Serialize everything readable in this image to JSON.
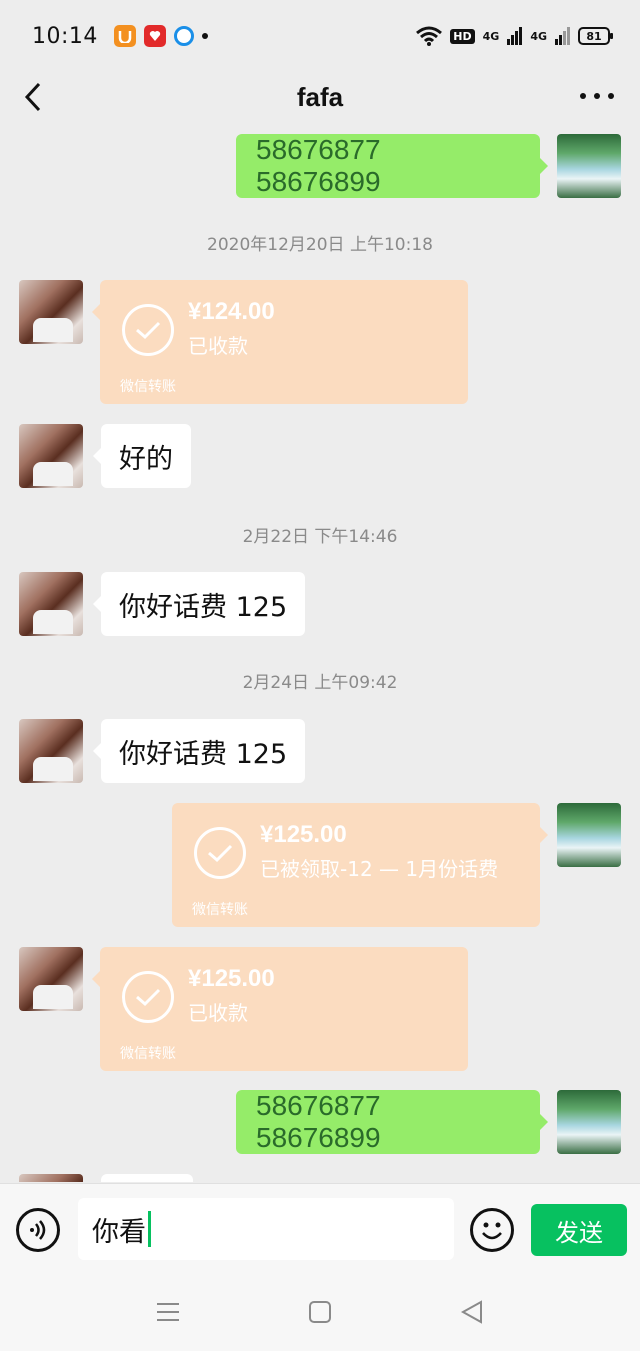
{
  "status_bar": {
    "time": "10:14",
    "battery": "81",
    "hd_label": "HD",
    "net_1": "4G",
    "net_2": "4G",
    "icons": [
      "uc-browser-icon",
      "app-red-icon",
      "app-blue-icon",
      "wifi-icon",
      "signal-icon",
      "battery-icon"
    ]
  },
  "header": {
    "title": "fafa",
    "back_icon": "back-chevron-icon",
    "more_icon": "more-dots-icon"
  },
  "messages": [
    {
      "type": "text",
      "side": "right",
      "text": "58676877   58676899"
    },
    {
      "type": "timestamp",
      "text": "2020年12月20日 上午10:18"
    },
    {
      "type": "transfer",
      "side": "left",
      "amount": "¥124.00",
      "status": "已收款",
      "footer": "微信转账"
    },
    {
      "type": "text",
      "side": "left",
      "text": "好的"
    },
    {
      "type": "timestamp",
      "text": "2月22日 下午14:46"
    },
    {
      "type": "text",
      "side": "left",
      "text": "你好话费 125"
    },
    {
      "type": "timestamp",
      "text": "2月24日 上午09:42"
    },
    {
      "type": "text",
      "side": "left",
      "text": "你好话费 125"
    },
    {
      "type": "transfer",
      "side": "right",
      "amount": "¥125.00",
      "status": "已被领取-12 — 1月份话费",
      "footer": "微信转账"
    },
    {
      "type": "transfer",
      "side": "left",
      "amount": "¥125.00",
      "status": "已收款",
      "footer": "微信转账"
    },
    {
      "type": "text",
      "side": "right",
      "text": "58676877   58676899"
    }
  ],
  "input": {
    "value": "你看",
    "send_label": "发送"
  },
  "colors": {
    "background": "#ededed",
    "own_bubble": "#95ec69",
    "transfer_bubble": "#fbdcc0",
    "send_button": "#07c160"
  }
}
